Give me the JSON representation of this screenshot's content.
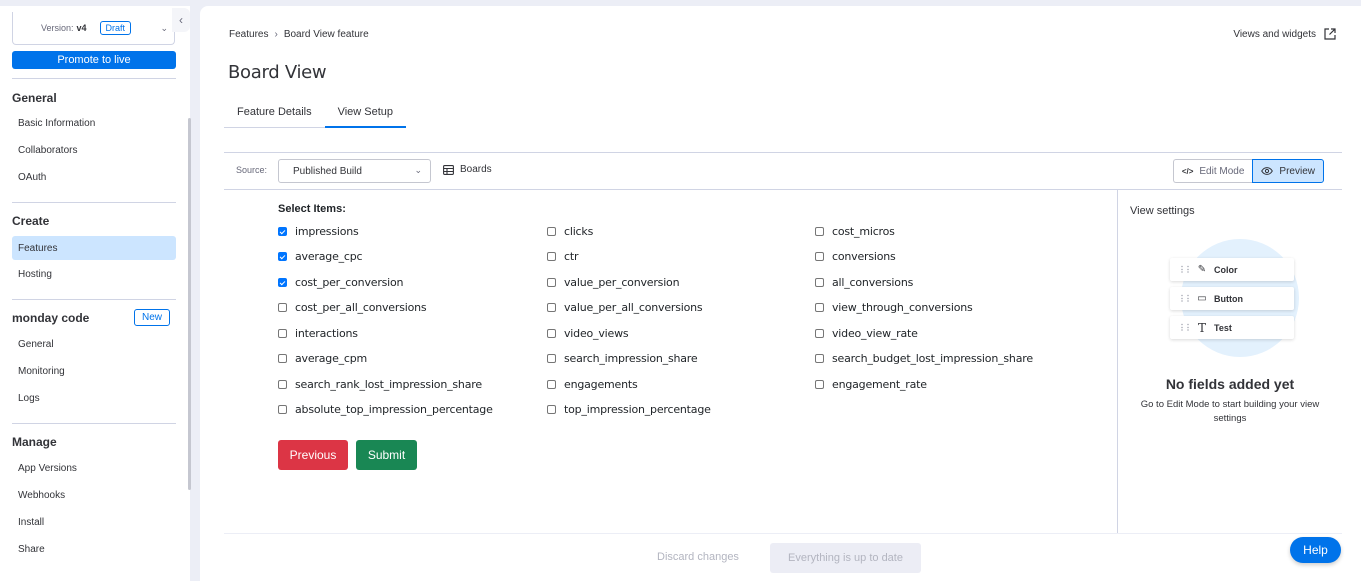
{
  "sidebar": {
    "version_label": "Version:",
    "version_value": "v4",
    "version_status": "Draft",
    "promote_label": "Promote to live",
    "sections": [
      {
        "heading": "General",
        "items": [
          "Basic Information",
          "Collaborators",
          "OAuth"
        ]
      },
      {
        "heading": "Create",
        "items": [
          "Features",
          "Hosting"
        ],
        "active": "Features"
      },
      {
        "heading": "monday code",
        "badge": "New",
        "items": [
          "General",
          "Monitoring",
          "Logs"
        ]
      },
      {
        "heading": "Manage",
        "items": [
          "App Versions",
          "Webhooks",
          "Install",
          "Share"
        ]
      }
    ]
  },
  "header": {
    "breadcrumb": [
      "Features",
      "Board View feature"
    ],
    "views_link": "Views and widgets",
    "title": "Board View",
    "tabs": [
      {
        "label": "Feature Details",
        "active": false
      },
      {
        "label": "View Setup",
        "active": true
      }
    ]
  },
  "toolbar": {
    "source_label": "Source:",
    "source_value": "Published Build",
    "boards_label": "Boards",
    "edit_mode_label": "Edit Mode",
    "preview_label": "Preview",
    "mode": "Preview"
  },
  "form": {
    "title": "Select Items:",
    "columns": [
      [
        {
          "label": "impressions",
          "checked": true
        },
        {
          "label": "average_cpc",
          "checked": true
        },
        {
          "label": "cost_per_conversion",
          "checked": true
        },
        {
          "label": "cost_per_all_conversions",
          "checked": false
        },
        {
          "label": "interactions",
          "checked": false
        },
        {
          "label": "average_cpm",
          "checked": false
        },
        {
          "label": "search_rank_lost_impression_share",
          "checked": false
        },
        {
          "label": "absolute_top_impression_percentage",
          "checked": false
        }
      ],
      [
        {
          "label": "clicks",
          "checked": false
        },
        {
          "label": "ctr",
          "checked": false
        },
        {
          "label": "value_per_conversion",
          "checked": false
        },
        {
          "label": "value_per_all_conversions",
          "checked": false
        },
        {
          "label": "video_views",
          "checked": false
        },
        {
          "label": "search_impression_share",
          "checked": false
        },
        {
          "label": "engagements",
          "checked": false
        },
        {
          "label": "top_impression_percentage",
          "checked": false
        }
      ],
      [
        {
          "label": "cost_micros",
          "checked": false
        },
        {
          "label": "conversions",
          "checked": false
        },
        {
          "label": "all_conversions",
          "checked": false
        },
        {
          "label": "view_through_conversions",
          "checked": false
        },
        {
          "label": "video_view_rate",
          "checked": false
        },
        {
          "label": "search_budget_lost_impression_share",
          "checked": false
        },
        {
          "label": "engagement_rate",
          "checked": false
        }
      ]
    ],
    "previous_label": "Previous",
    "submit_label": "Submit"
  },
  "view_settings": {
    "title": "View settings",
    "sample_fields": [
      {
        "label": "Color",
        "icon": "pencil-icon"
      },
      {
        "label": "Button",
        "icon": "button-icon"
      },
      {
        "label": "Test",
        "icon": "text-icon"
      }
    ],
    "empty_title": "No fields added yet",
    "empty_subtitle": "Go to Edit Mode to start building your view settings"
  },
  "footer": {
    "discard_label": "Discard changes",
    "status_label": "Everything is up to date"
  },
  "help_label": "Help"
}
